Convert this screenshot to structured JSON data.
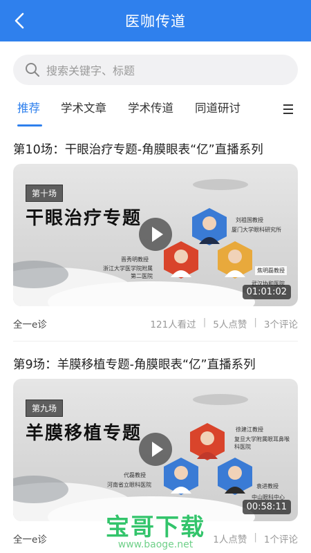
{
  "header": {
    "title": "医咖传道"
  },
  "search": {
    "placeholder": "搜索关键字、标题"
  },
  "tabs": [
    {
      "label": "推荐",
      "active": true
    },
    {
      "label": "学术文章",
      "active": false
    },
    {
      "label": "学术传道",
      "active": false
    },
    {
      "label": "同道研讨",
      "active": false
    }
  ],
  "colors": {
    "primary": "#2f80ed",
    "watermark": "#33c46b"
  },
  "cards": [
    {
      "title": "第10场：干眼治疗专题-角膜眼表“亿”直播系列",
      "badge": "第十场",
      "headline": "干眼治疗专题",
      "speakers": [
        {
          "caption": "刘祖国教授",
          "affiliation": "厦门大学眼科研究所"
        },
        {
          "caption": "晋秀明教授",
          "affiliation": "浙江大学医学院附属\n第二医院"
        },
        {
          "caption": "焦明磊教授",
          "affiliation": "武汉协和医院"
        }
      ],
      "duration": "01:01:02",
      "author": "全一e诊",
      "stats": [
        "121人看过",
        "5人点赞",
        "3个评论"
      ]
    },
    {
      "title": "第9场：羊膜移植专题-角膜眼表“亿”直播系列",
      "badge": "第九场",
      "headline": "羊膜移植专题",
      "speakers": [
        {
          "caption": "徐建江教授",
          "affiliation": "复旦大学附属眼耳鼻喉\n科医院"
        },
        {
          "caption": "代磊教授",
          "affiliation": "河南省立眼科医院"
        },
        {
          "caption": "袁进教授",
          "affiliation": "中山眼科中心"
        }
      ],
      "duration": "00:58:11",
      "author": "全一e诊",
      "stats": [
        "1人点赞",
        "1个评论"
      ]
    }
  ],
  "watermark": {
    "main": "宝哥下载",
    "url": "www.baoge.net"
  }
}
